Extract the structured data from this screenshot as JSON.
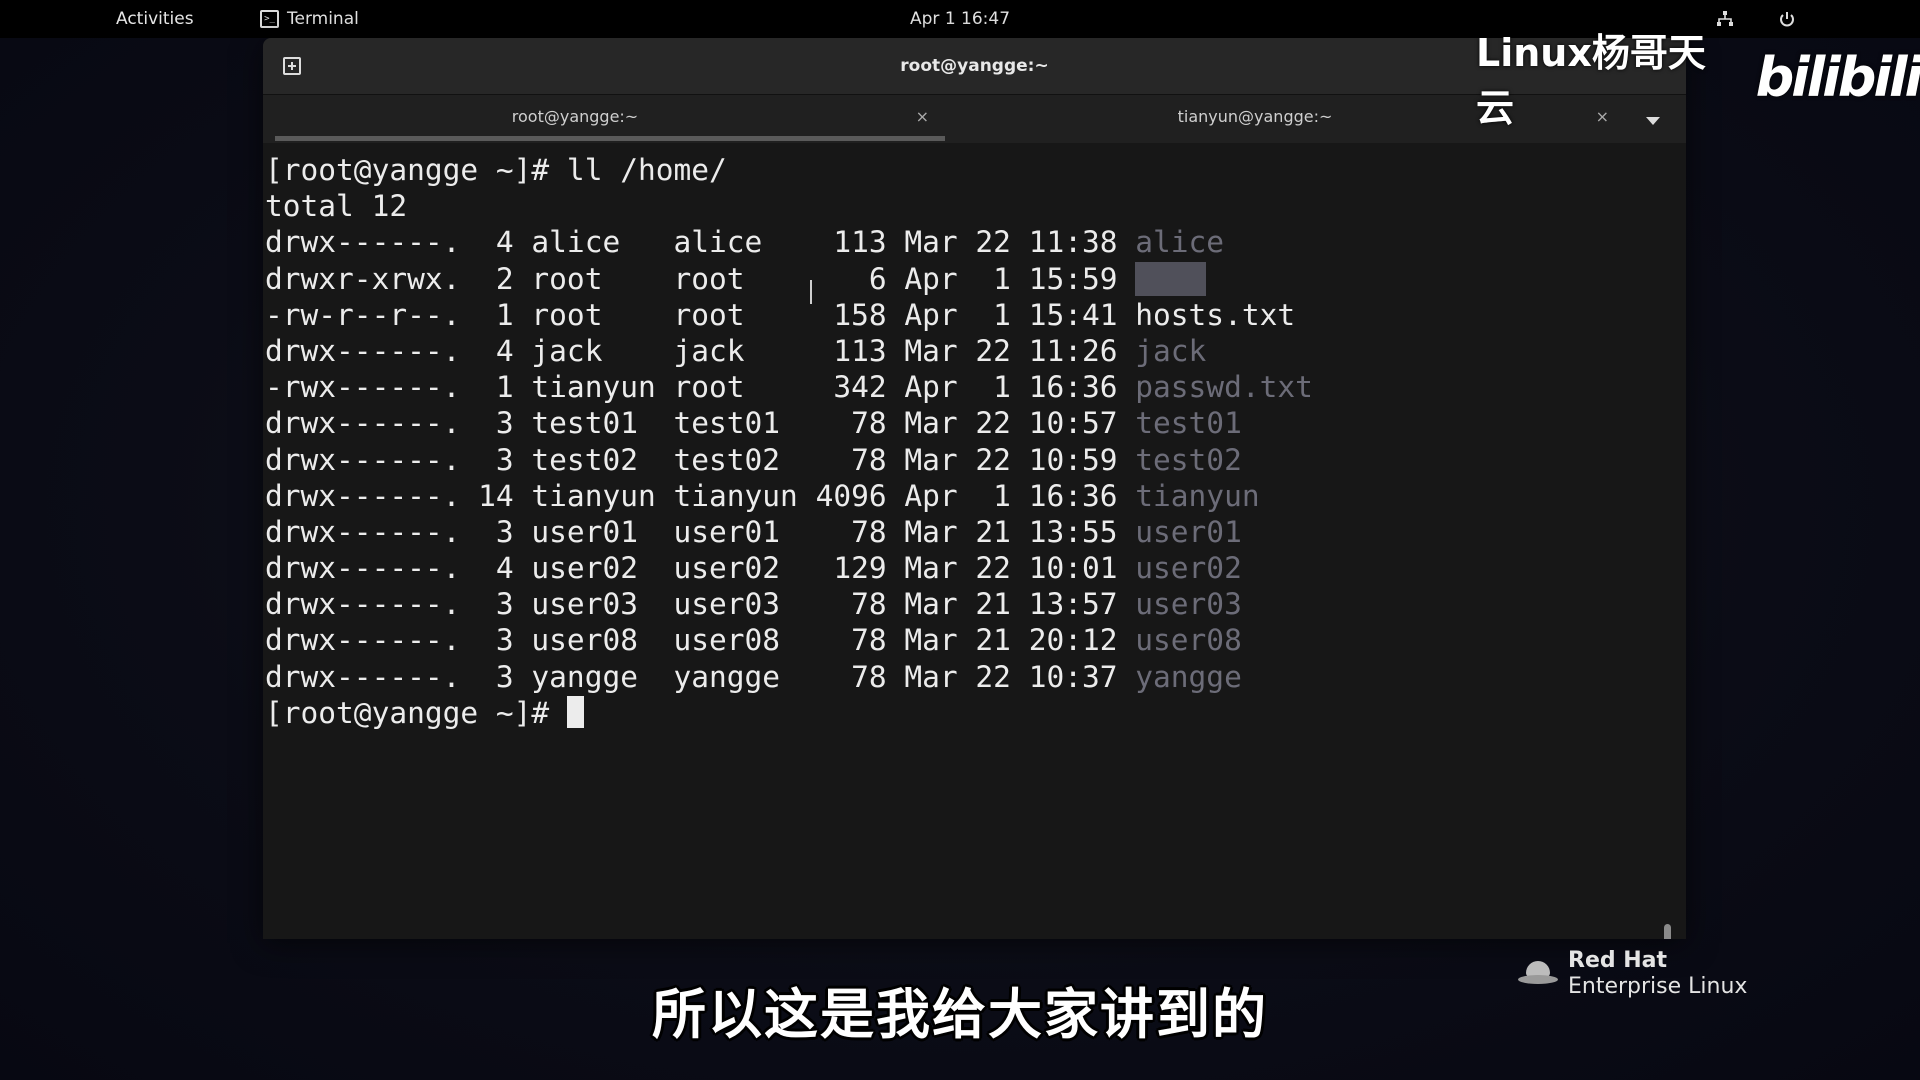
{
  "topbar": {
    "activities": "Activities",
    "app_name": "Terminal",
    "clock": "Apr 1  16:47",
    "network_icon": "network-icon",
    "power_icon": "power-icon"
  },
  "window": {
    "title": "root@yangge:~",
    "tabs": [
      {
        "label": "root@yangge:~",
        "close": "×",
        "active": true
      },
      {
        "label": "tianyun@yangge:~",
        "close": "×",
        "active": false
      }
    ]
  },
  "terminal": {
    "lines": [
      {
        "segments": [
          {
            "text": "[root@yangge ~]# ll /home/",
            "style": "plain"
          }
        ]
      },
      {
        "segments": [
          {
            "text": "total 12",
            "style": "plain"
          }
        ]
      },
      {
        "segments": [
          {
            "text": "drwx------.  4 alice   alice    113 Mar 22 11:38 ",
            "style": "plain"
          },
          {
            "text": "alice",
            "style": "dir"
          }
        ]
      },
      {
        "segments": [
          {
            "text": "drwxr-xrwx.  2 root    root       6 Apr  1 15:59 ",
            "style": "plain"
          },
          {
            "text": "    ",
            "style": "dir-hl"
          }
        ]
      },
      {
        "segments": [
          {
            "text": "-rw-r--r--.  1 root    root     158 Apr  1 15:41 ",
            "style": "plain"
          },
          {
            "text": "hosts.txt",
            "style": "plain"
          }
        ]
      },
      {
        "segments": [
          {
            "text": "drwx------.  4 jack    jack     113 Mar 22 11:26 ",
            "style": "plain"
          },
          {
            "text": "jack",
            "style": "dir"
          }
        ]
      },
      {
        "segments": [
          {
            "text": "-rwx------.  1 tianyun root     342 Apr  1 16:36 ",
            "style": "plain"
          },
          {
            "text": "passwd.txt",
            "style": "dir"
          }
        ]
      },
      {
        "segments": [
          {
            "text": "drwx------.  3 test01  test01    78 Mar 22 10:57 ",
            "style": "plain"
          },
          {
            "text": "test01",
            "style": "dir"
          }
        ]
      },
      {
        "segments": [
          {
            "text": "drwx------.  3 test02  test02    78 Mar 22 10:59 ",
            "style": "plain"
          },
          {
            "text": "test02",
            "style": "dir"
          }
        ]
      },
      {
        "segments": [
          {
            "text": "drwx------. 14 tianyun tianyun 4096 Apr  1 16:36 ",
            "style": "plain"
          },
          {
            "text": "tianyun",
            "style": "dir"
          }
        ]
      },
      {
        "segments": [
          {
            "text": "drwx------.  3 user01  user01    78 Mar 21 13:55 ",
            "style": "plain"
          },
          {
            "text": "user01",
            "style": "dir"
          }
        ]
      },
      {
        "segments": [
          {
            "text": "drwx------.  4 user02  user02   129 Mar 22 10:01 ",
            "style": "plain"
          },
          {
            "text": "user02",
            "style": "dir"
          }
        ]
      },
      {
        "segments": [
          {
            "text": "drwx------.  3 user03  user03    78 Mar 21 13:57 ",
            "style": "plain"
          },
          {
            "text": "user03",
            "style": "dir"
          }
        ]
      },
      {
        "segments": [
          {
            "text": "drwx------.  3 user08  user08    78 Mar 21 20:12 ",
            "style": "plain"
          },
          {
            "text": "user08",
            "style": "dir"
          }
        ]
      },
      {
        "segments": [
          {
            "text": "drwx------.  3 yangge  yangge    78 Mar 22 10:37 ",
            "style": "plain"
          },
          {
            "text": "yangge",
            "style": "dir"
          }
        ]
      }
    ],
    "prompt": "[root@yangge ~]# "
  },
  "overlay": {
    "watermark_text": "Linux杨哥天云",
    "watermark_logo": "bilibili",
    "redhat_brand": "Red Hat",
    "redhat_product": "Enterprise Linux",
    "subtitle": "所以这是我给大家讲到的"
  },
  "colors": {
    "terminal_bg": "#171717",
    "terminal_fg": "#ececec",
    "directory_fg": "#6c6c78",
    "topbar_bg": "#000000"
  }
}
